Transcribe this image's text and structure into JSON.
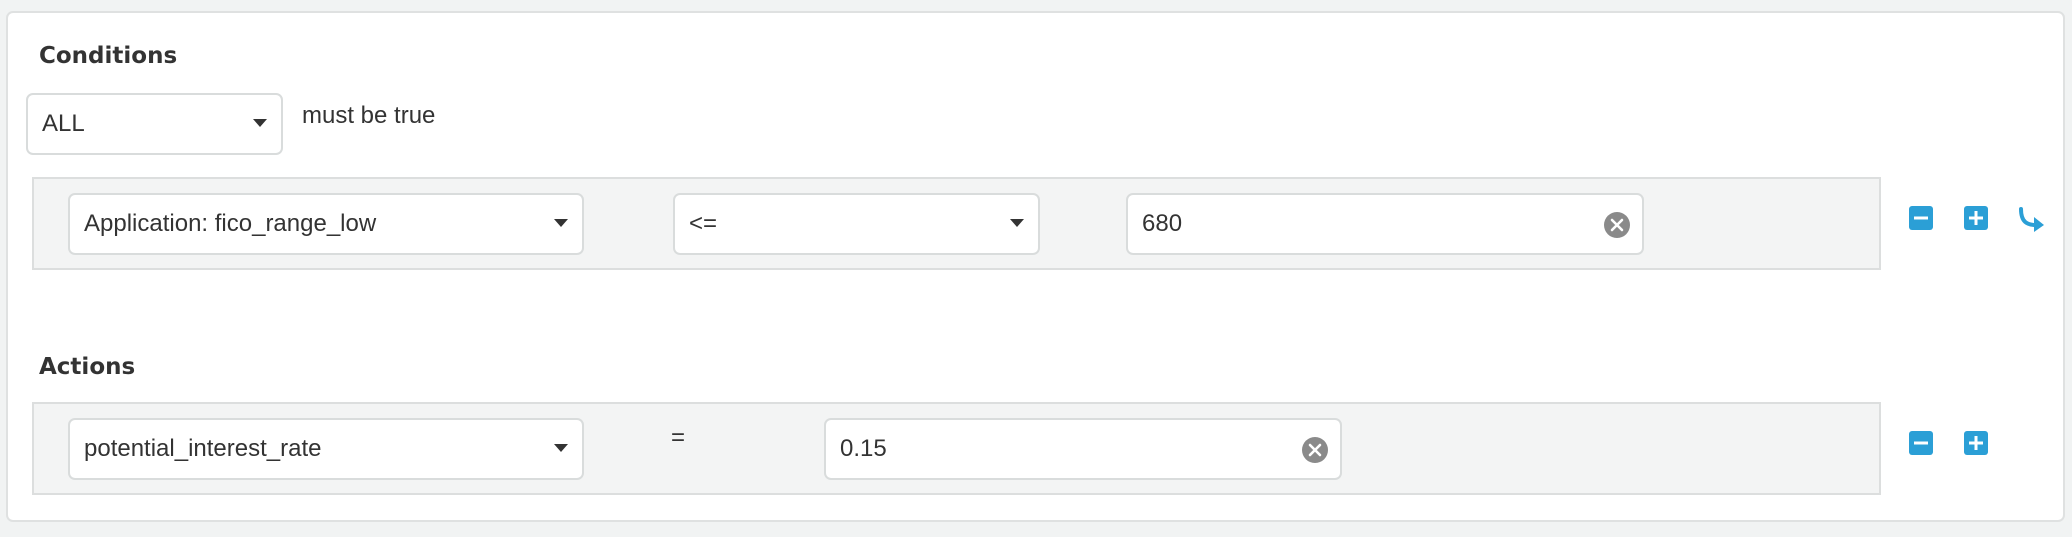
{
  "conditions": {
    "title": "Conditions",
    "match_mode": "ALL",
    "match_suffix": "must be true",
    "rule": {
      "field": "Application: fico_range_low",
      "operator": "<=",
      "value": "680"
    }
  },
  "actions": {
    "title": "Actions",
    "rule": {
      "field": "potential_interest_rate",
      "operator": "=",
      "value": "0.15"
    }
  },
  "icons": {
    "remove": "minus-square-icon",
    "add": "plus-square-icon",
    "indent": "share-arrow-icon",
    "clear": "clear-circle-icon",
    "dropdown": "caret-down-icon"
  },
  "colors": {
    "accent": "#2b9fd6",
    "row_background": "#f3f4f4",
    "page_background": "#f1f3f3"
  }
}
